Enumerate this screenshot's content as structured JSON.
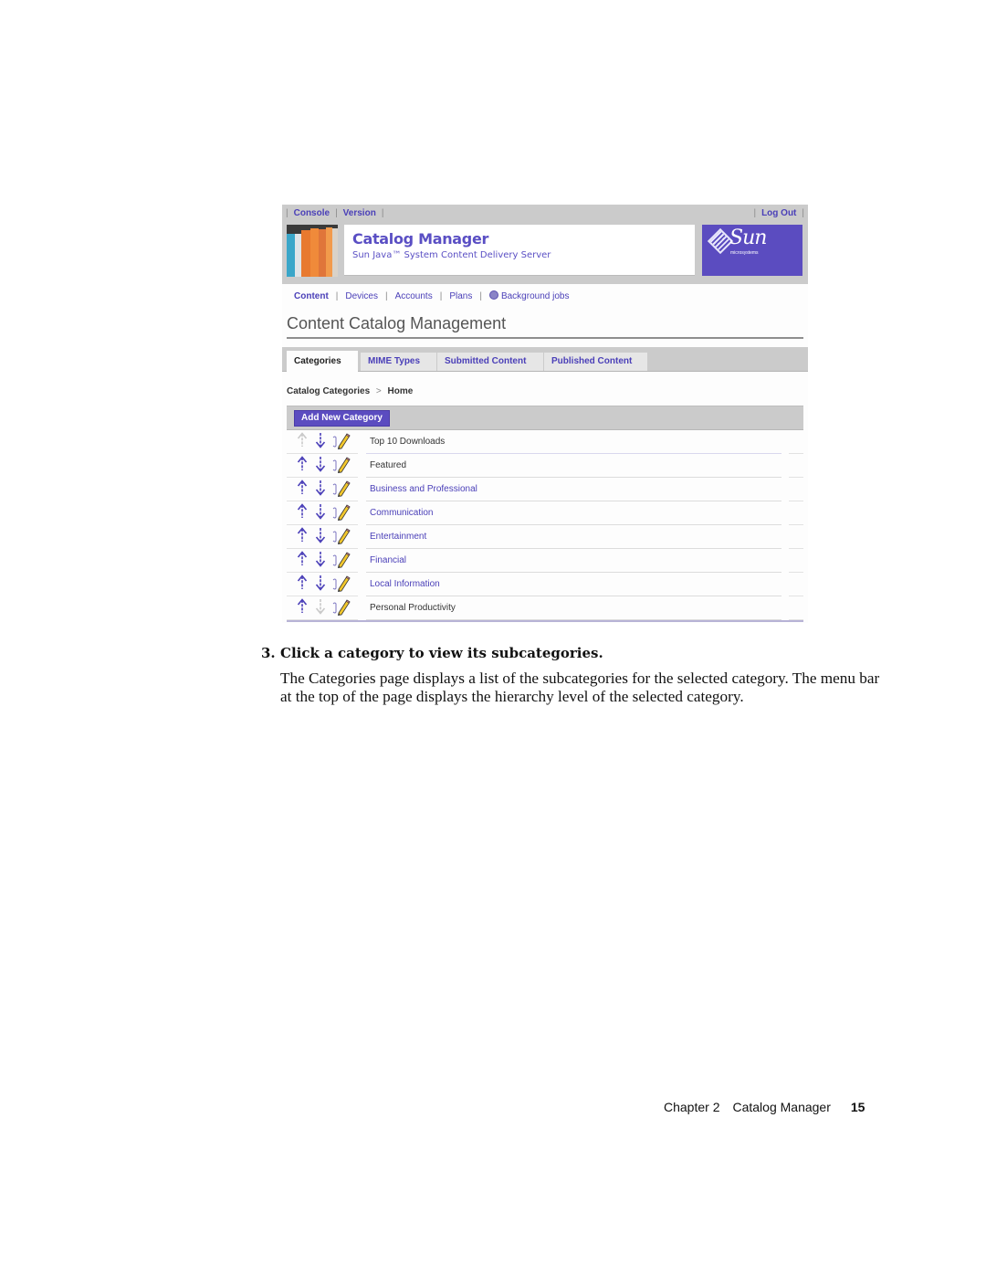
{
  "masthead": {
    "utility_links": [
      "Console",
      "Version"
    ],
    "logout_label": "Log Out",
    "app_title": "Catalog Manager",
    "app_subtitle": "Sun Java™ System Content Delivery Server",
    "logo_text": "Sun",
    "logo_subtext": "microsystems"
  },
  "nav": {
    "items": [
      {
        "label": "Content",
        "active": true
      },
      {
        "label": "Devices"
      },
      {
        "label": "Accounts"
      },
      {
        "label": "Plans"
      },
      {
        "label": "Background jobs",
        "icon": "globe-icon"
      }
    ]
  },
  "page_title": "Content Catalog Management",
  "tabs": [
    {
      "label": "Categories",
      "active": true
    },
    {
      "label": "MIME Types"
    },
    {
      "label": "Submitted Content"
    },
    {
      "label": "Published Content"
    }
  ],
  "breadcrumb": {
    "root": "Catalog Categories",
    "separator": ">",
    "current": "Home"
  },
  "actions": {
    "add_category_label": "Add New Category"
  },
  "categories": [
    {
      "label": "Top 10 Downloads",
      "link": false,
      "up_enabled": false,
      "down_enabled": true
    },
    {
      "label": "Featured",
      "link": false,
      "up_enabled": true,
      "down_enabled": true
    },
    {
      "label": "Business and Professional",
      "link": true,
      "up_enabled": true,
      "down_enabled": true
    },
    {
      "label": "Communication",
      "link": true,
      "up_enabled": true,
      "down_enabled": true
    },
    {
      "label": "Entertainment",
      "link": true,
      "up_enabled": true,
      "down_enabled": true
    },
    {
      "label": "Financial",
      "link": true,
      "up_enabled": true,
      "down_enabled": true
    },
    {
      "label": "Local Information",
      "link": true,
      "up_enabled": true,
      "down_enabled": true
    },
    {
      "label": "Personal Productivity",
      "link": false,
      "up_enabled": true,
      "down_enabled": false
    }
  ],
  "colors": {
    "accent": "#5b4cc0",
    "link": "#4a3fb8",
    "chrome_gray": "#cbcbcb"
  },
  "document": {
    "step_number": "3.",
    "step_text": "Click a category to view its subcategories.",
    "paragraph": "The Categories page displays a list of the subcategories for the selected category. The menu bar at the top of the page displays the hierarchy level of the selected category.",
    "footer_chapter": "Chapter 2",
    "footer_title": "Catalog Manager",
    "footer_page": "15"
  }
}
